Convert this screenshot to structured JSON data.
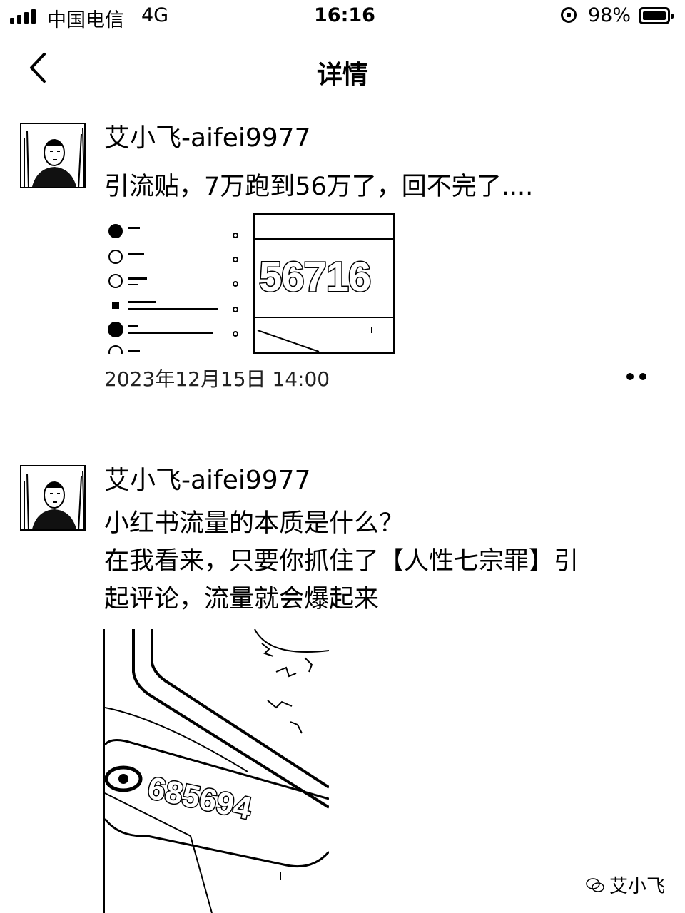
{
  "status_bar": {
    "carrier": "中国电信",
    "network": "4G",
    "time": "16:16",
    "battery": "98%",
    "icons": [
      "signal-icon",
      "rotation-lock-icon",
      "battery-icon"
    ]
  },
  "nav": {
    "title": "详情",
    "back_icon": "chevron-left-icon"
  },
  "posts": [
    {
      "author": "艾小飞-aifei9977",
      "lines": [
        "引流贴，7万跑到56万了，回不完了...."
      ],
      "big_number": "56716",
      "timestamp": "2023年12月15日 14:00",
      "more_icon": "more-icon"
    },
    {
      "author": "艾小飞-aifei9977",
      "lines": [
        "小红书流量的本质是什么？",
        "在我看来，只要你抓住了【人性七宗罪】引",
        "起评论，流量就会爆起来"
      ],
      "big_number": "685694"
    }
  ],
  "watermark": "艾小飞"
}
